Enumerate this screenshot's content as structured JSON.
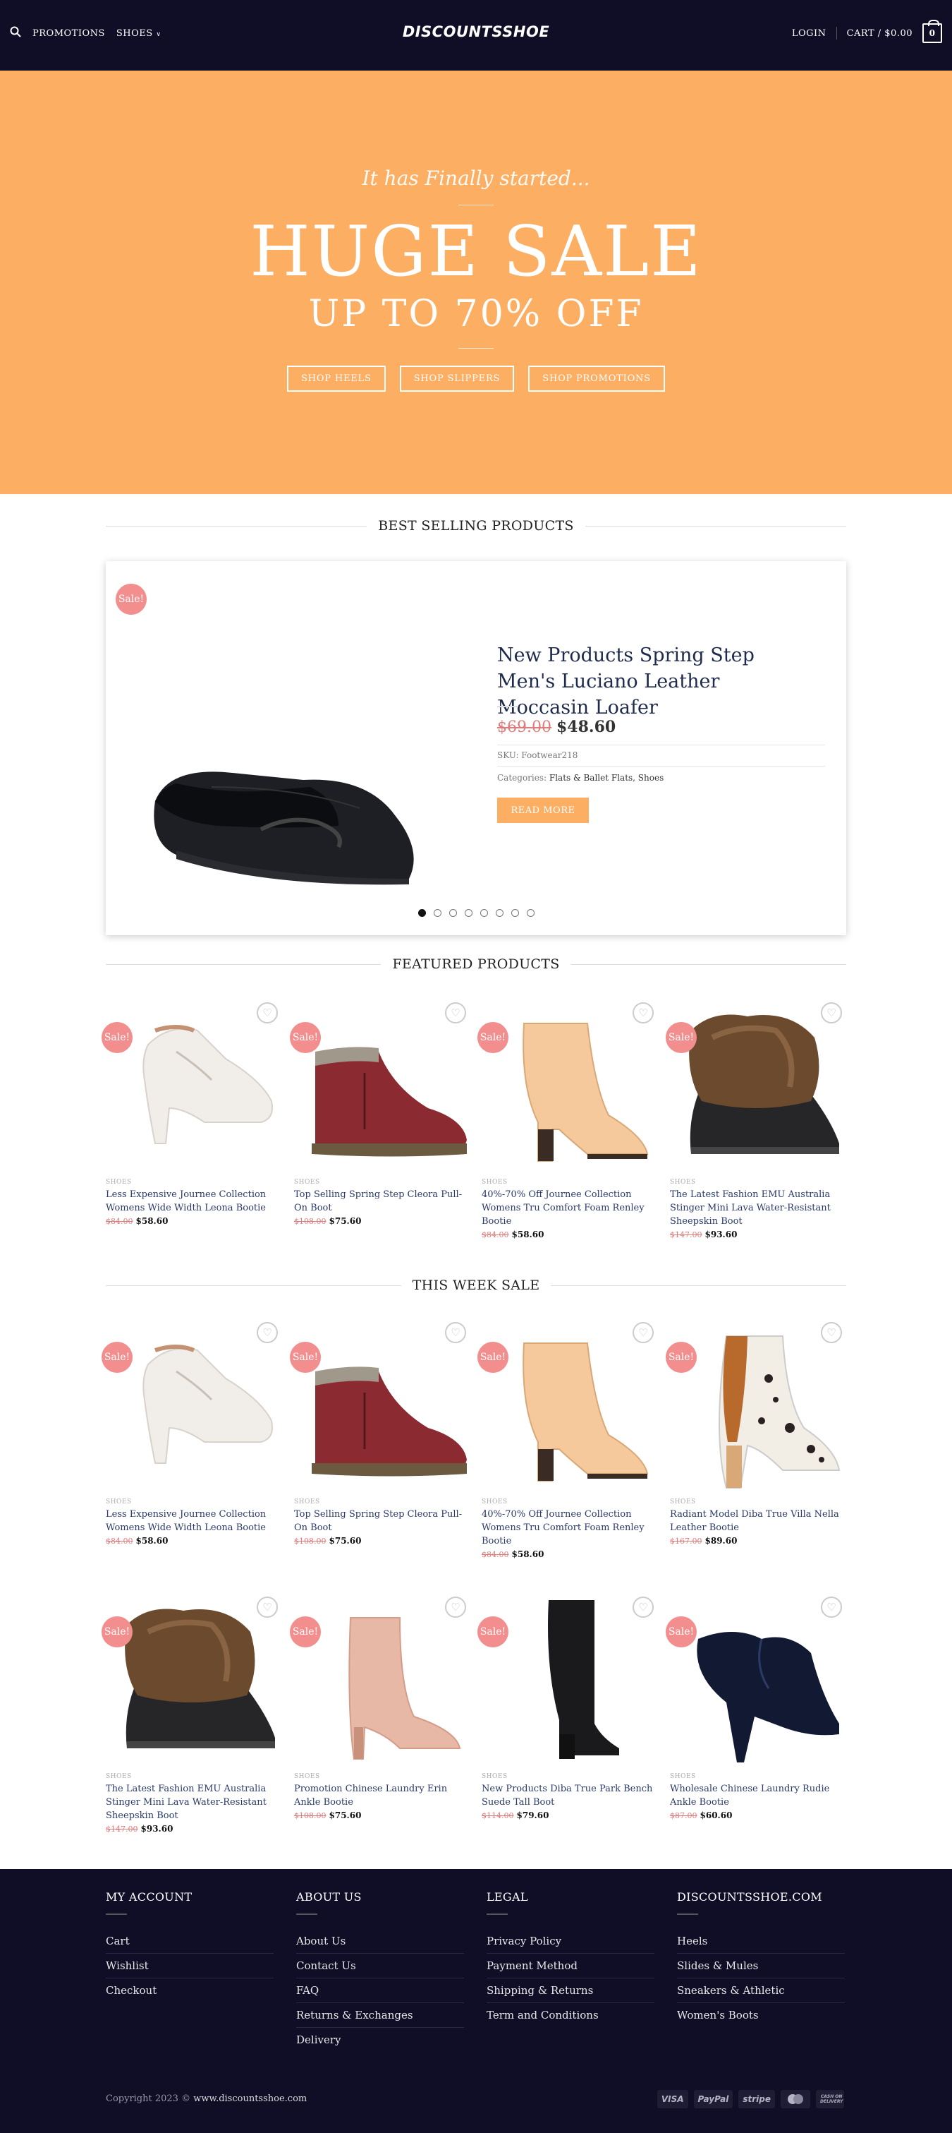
{
  "header": {
    "promotions": "PROMOTIONS",
    "shoes": "SHOES",
    "logo": "DISCOUNTSSHOE",
    "login": "LOGIN",
    "cart": "CART / $0.00",
    "cart_count": "0"
  },
  "hero": {
    "tagline": "It has Finally started...",
    "title": "HUGE SALE",
    "subtitle": "UP TO 70% OFF",
    "buttons": [
      "SHOP HEELS",
      "SHOP SLIPPERS",
      "SHOP PROMOTIONS"
    ],
    "bg_color": "#fcae63"
  },
  "best": {
    "heading": "BEST SELLING PRODUCTS",
    "sale": "Sale!",
    "title": "New Products Spring Step Men's Luciano Leather Moccasin Loafer",
    "old_price": "$69.00",
    "price": "$48.60",
    "sku": "SKU: Footwear218",
    "categories_label": "Categories:",
    "categories": "Flats & Ballet Flats, Shoes",
    "read_more": "READ MORE",
    "slides": 8,
    "active_slide": 1
  },
  "featured": {
    "heading": "FEATURED PRODUCTS",
    "items": [
      {
        "sale": "Sale!",
        "cat": "SHOES",
        "name": "Less Expensive Journee Collection Womens Wide Width Leona Bootie",
        "old": "$84.00",
        "now": "$58.60",
        "icon": "heart-icon"
      },
      {
        "sale": "Sale!",
        "cat": "SHOES",
        "name": "Top Selling Spring Step Cleora Pull-On Boot",
        "old": "$108.00",
        "now": "$75.60",
        "icon": "heart-icon"
      },
      {
        "sale": "Sale!",
        "cat": "SHOES",
        "name": "40%-70% Off Journee Collection Womens Tru Comfort Foam Renley Bootie",
        "old": "$84.00",
        "now": "$58.60",
        "icon": "heart-icon"
      },
      {
        "sale": "Sale!",
        "cat": "SHOES",
        "name": "The Latest Fashion EMU Australia Stinger Mini Lava Water-Resistant Sheepskin Boot",
        "old": "$147.00",
        "now": "$93.60",
        "icon": "heart-icon"
      }
    ]
  },
  "week": {
    "heading": "THIS WEEK SALE",
    "items": [
      {
        "sale": "Sale!",
        "cat": "SHOES",
        "name": "Less Expensive Journee Collection Womens Wide Width Leona Bootie",
        "old": "$84.00",
        "now": "$58.60"
      },
      {
        "sale": "Sale!",
        "cat": "SHOES",
        "name": "Top Selling Spring Step Cleora Pull-On Boot",
        "old": "$108.00",
        "now": "$75.60"
      },
      {
        "sale": "Sale!",
        "cat": "SHOES",
        "name": "40%-70% Off Journee Collection Womens Tru Comfort Foam Renley Bootie",
        "old": "$84.00",
        "now": "$58.60"
      },
      {
        "sale": "Sale!",
        "cat": "SHOES",
        "name": "Radiant Model Diba True Villa Nella Leather Bootie",
        "old": "$167.00",
        "now": "$89.60"
      },
      {
        "sale": "Sale!",
        "cat": "SHOES",
        "name": "The Latest Fashion EMU Australia Stinger Mini Lava Water-Resistant Sheepskin Boot",
        "old": "$147.00",
        "now": "$93.60"
      },
      {
        "sale": "Sale!",
        "cat": "SHOES",
        "name": "Promotion Chinese Laundry Erin Ankle Bootie",
        "old": "$108.00",
        "now": "$75.60"
      },
      {
        "sale": "Sale!",
        "cat": "SHOES",
        "name": "New Products Diba True Park Bench Suede Tall Boot",
        "old": "$114.00",
        "now": "$79.60"
      },
      {
        "sale": "Sale!",
        "cat": "SHOES",
        "name": "Wholesale Chinese Laundry Rudie Ankle Bootie",
        "old": "$87.00",
        "now": "$60.60"
      }
    ]
  },
  "footer": {
    "cols": [
      {
        "title": "MY ACCOUNT",
        "items": [
          "Cart",
          "Wishlist",
          "Checkout"
        ]
      },
      {
        "title": "ABOUT US",
        "items": [
          "About Us",
          "Contact Us",
          "FAQ",
          "Returns & Exchanges",
          "Delivery"
        ]
      },
      {
        "title": "LEGAL",
        "items": [
          "Privacy Policy",
          "Payment Method",
          "Shipping & Returns",
          "Term and Conditions"
        ]
      },
      {
        "title": "DISCOUNTSSHOE.COM",
        "items": [
          "Heels",
          "Slides & Mules",
          "Sneakers & Athletic",
          "Women's Boots"
        ]
      }
    ],
    "copyright": "Copyright 2023 ©",
    "site": "www.discountsshoe.com",
    "payments": [
      "VISA",
      "PayPal",
      "stripe",
      "mastercard",
      "CASH ON DELIVERY"
    ]
  }
}
